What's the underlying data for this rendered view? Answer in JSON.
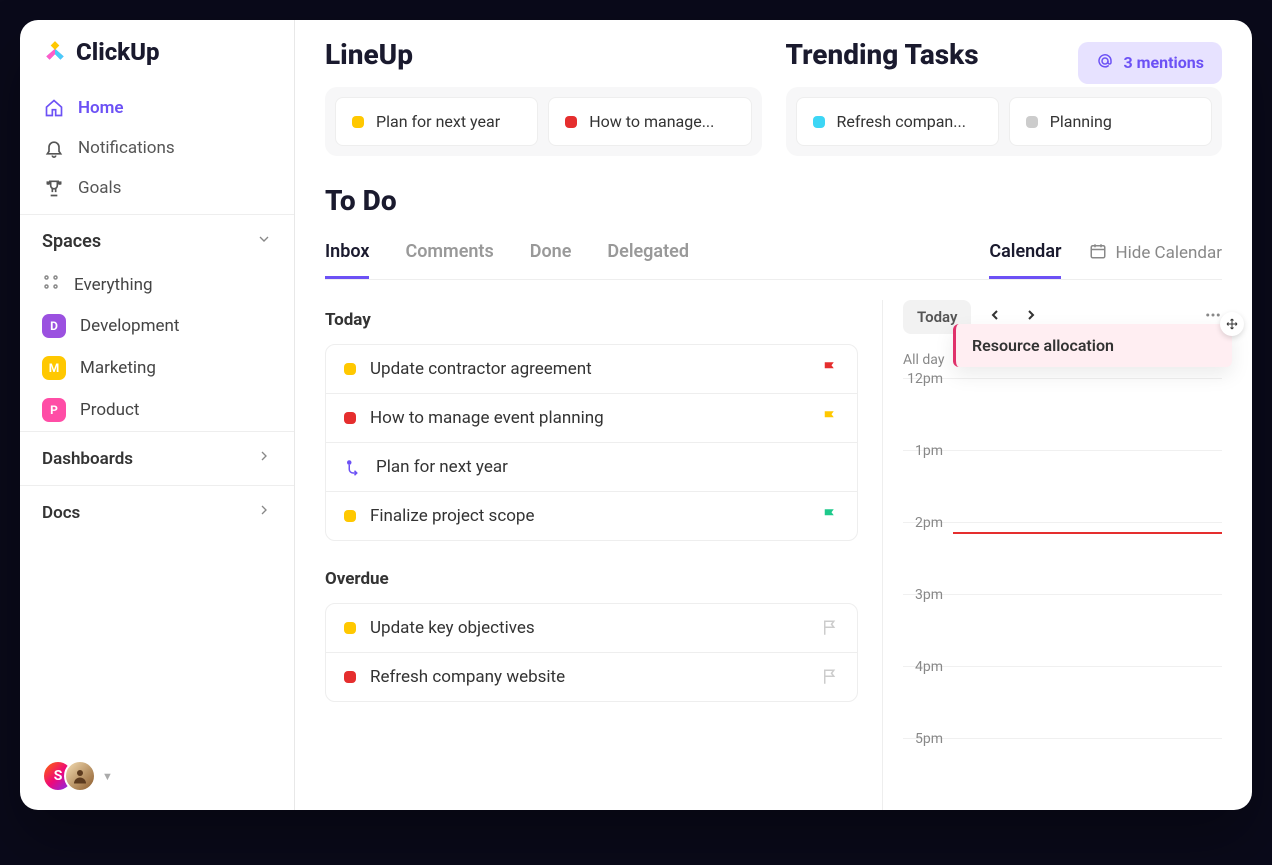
{
  "brand": "ClickUp",
  "sidebar": {
    "nav": [
      {
        "label": "Home",
        "icon": "home-icon",
        "active": true
      },
      {
        "label": "Notifications",
        "icon": "bell-icon",
        "active": false
      },
      {
        "label": "Goals",
        "icon": "trophy-icon",
        "active": false
      }
    ],
    "spaces_header": "Spaces",
    "everything": "Everything",
    "spaces": [
      {
        "letter": "D",
        "label": "Development",
        "class": "badge-d"
      },
      {
        "letter": "M",
        "label": "Marketing",
        "class": "badge-m"
      },
      {
        "letter": "P",
        "label": "Product",
        "class": "badge-p"
      }
    ],
    "dashboards": "Dashboards",
    "docs": "Docs",
    "avatar_letter": "S"
  },
  "lineup": {
    "title": "LineUp",
    "tasks": [
      {
        "label": "Plan for next year",
        "dot": "dot-yellow"
      },
      {
        "label": "How to manage...",
        "dot": "dot-red"
      }
    ]
  },
  "trending": {
    "title": "Trending Tasks",
    "mentions_text": "3 mentions",
    "tasks": [
      {
        "label": "Refresh compan...",
        "dot": "dot-cyan"
      },
      {
        "label": "Planning",
        "dot": "dot-grey"
      }
    ]
  },
  "todo": {
    "title": "To Do",
    "tabs": [
      "Inbox",
      "Comments",
      "Done",
      "Delegated"
    ],
    "active_tab": "Inbox",
    "calendar_tab": "Calendar",
    "hide_calendar": "Hide Calendar",
    "groups": {
      "today_label": "Today",
      "today": [
        {
          "label": "Update contractor agreement",
          "dot": "dot-yellow",
          "flag": "flag-red"
        },
        {
          "label": "How to manage event planning",
          "dot": "dot-red",
          "flag": "flag-yellow"
        },
        {
          "label": "Plan for next year",
          "icon": "merge",
          "flag": ""
        },
        {
          "label": "Finalize project scope",
          "dot": "dot-yellow",
          "flag": "flag-green"
        }
      ],
      "overdue_label": "Overdue",
      "overdue": [
        {
          "label": "Update key objectives",
          "dot": "dot-yellow",
          "flag": "flag-empty"
        },
        {
          "label": "Refresh company website",
          "dot": "dot-red",
          "flag": "flag-empty"
        }
      ]
    }
  },
  "calendar": {
    "today_chip": "Today",
    "allday": "All day",
    "times": [
      "12pm",
      "1pm",
      "2pm",
      "3pm",
      "4pm",
      "5pm"
    ],
    "event": "Resource allocation"
  }
}
